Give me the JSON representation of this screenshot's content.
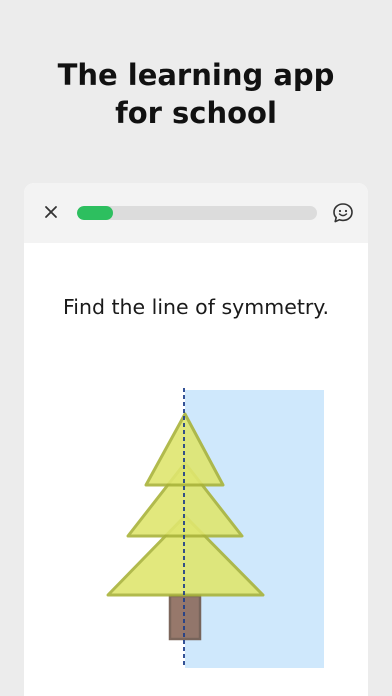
{
  "headline": {
    "line1": "The learning app",
    "line2": "for school"
  },
  "header": {
    "close_icon": "close-icon",
    "feedback_icon": "chat-smiley-icon",
    "progress": 0.15,
    "progress_color": "#2dbf5f"
  },
  "exercise": {
    "prompt": "Find the line of symmetry."
  },
  "colors": {
    "tree_fill": "#dfe66f",
    "tree_stroke": "#a9b33a",
    "trunk_fill": "#8c6a5c",
    "trunk_stroke": "#6e564a",
    "highlight": "#bfe0fb",
    "symmetry_line": "#1f3f8a"
  }
}
